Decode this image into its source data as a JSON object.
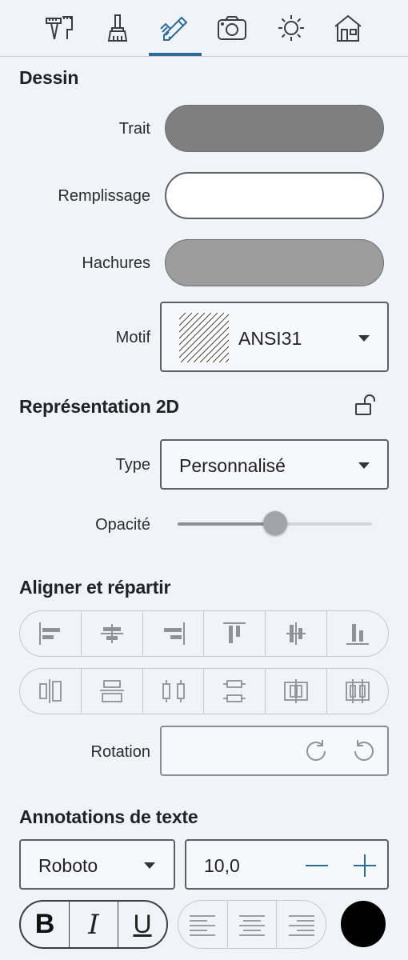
{
  "tabs": [
    {
      "icon": "measure-tools-icon"
    },
    {
      "icon": "paint-brush-icon"
    },
    {
      "icon": "pencil-ruler-icon",
      "active": true
    },
    {
      "icon": "camera-icon"
    },
    {
      "icon": "sun-icon"
    },
    {
      "icon": "house-icon"
    }
  ],
  "dessin": {
    "title": "Dessin",
    "trait_label": "Trait",
    "trait_color": "#7f7f7f",
    "remplissage_label": "Remplissage",
    "remplissage_color": "#ffffff",
    "hachures_label": "Hachures",
    "hachures_color": "#9c9c9c",
    "motif_label": "Motif",
    "motif_value": "ANSI31"
  },
  "representation": {
    "title": "Représentation 2D",
    "type_label": "Type",
    "type_value": "Personnalisé",
    "opacite_label": "Opacité",
    "opacite_value": 0.5
  },
  "aligner": {
    "title": "Aligner et répartir",
    "row1_icons": [
      "align-left-icon",
      "align-center-horizontal-icon",
      "align-right-icon",
      "align-top-icon",
      "align-middle-vertical-icon",
      "align-bottom-icon"
    ],
    "row2_icons": [
      "distribute-horizontal-centers-icon",
      "distribute-vertical-centers-icon",
      "distribute-horizontal-spacing-icon",
      "distribute-vertical-spacing-icon",
      "distribute-horizontal-fit-icon",
      "distribute-grid-icon"
    ],
    "rotation_label": "Rotation"
  },
  "annotations": {
    "title": "Annotations de texte",
    "font_value": "Roboto",
    "size_value": "10,0",
    "bold_label": "B",
    "italic_label": "I",
    "underline_label": "U",
    "text_color": "#000000"
  }
}
